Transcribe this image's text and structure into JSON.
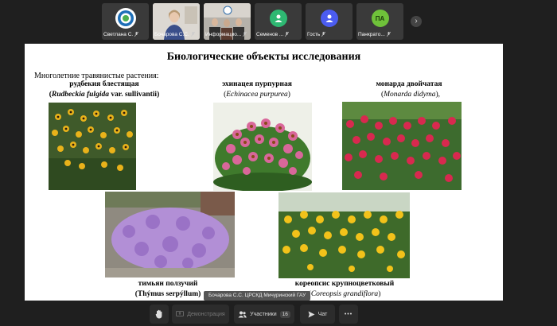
{
  "participants": [
    {
      "name": "Светлана С.",
      "kind": "logo"
    },
    {
      "name": "Бочарова С.С.",
      "kind": "video"
    },
    {
      "name": "Информацио...",
      "kind": "video"
    },
    {
      "name": "Семенов ...",
      "kind": "avatar",
      "color": "#2eb872"
    },
    {
      "name": "Гость",
      "kind": "avatar",
      "color": "#4b5cf0"
    },
    {
      "name": "Панкрато...",
      "kind": "initials",
      "initials": "ПА",
      "color": "#6fc23a"
    }
  ],
  "slide": {
    "title": "Биологические объекты исследования",
    "subhead": "Многолетние травянистые растения:",
    "plants": [
      {
        "name": "рудбекия блестящая",
        "latin_open": "(",
        "latin_genus": "Rudbeckia fulgida",
        "latin_rest": " var. sullivantii)"
      },
      {
        "name": "эхинацея пурпурная",
        "latin_open": "(",
        "latin_genus": "Echinacea purpurea",
        "latin_rest": ")"
      },
      {
        "name": "монарда двойчатая",
        "latin_open": "(",
        "latin_genus": "Monarda didyma",
        "latin_rest": "),"
      },
      {
        "name": "тимьян ползучий",
        "latin_open": "(",
        "latin_genus": "Thýmus serpýllum",
        "latin_rest": ")"
      },
      {
        "name": "кореопсис крупноцветковый",
        "latin_open": "(",
        "latin_genus": "Coreopsis grandiflora",
        "latin_rest": ")"
      }
    ]
  },
  "speaker_tag": "Бочарова С.С. ЦРСКД Мичуринский ГАУ",
  "toolbar": {
    "demo_label": "Демонстрация",
    "participants_label": "Участники",
    "participants_count": "16",
    "chat_label": "Чат",
    "more_label": "•••"
  },
  "colors": {
    "background": "#1f1f1f",
    "tile": "#3a3a3a",
    "button": "#2c2c2c"
  }
}
